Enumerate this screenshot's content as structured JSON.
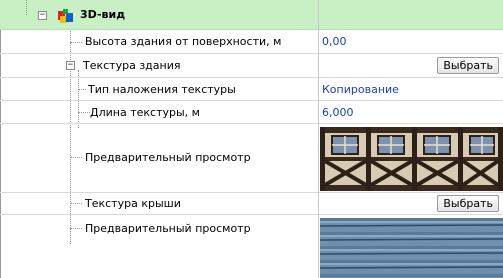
{
  "section": {
    "title": "3D-вид",
    "expander": "−",
    "icon": "3d-blocks-icon",
    "colors": {
      "header_bg": "#c8f0c4",
      "value_text": "#1a3fb3"
    }
  },
  "properties": {
    "height": {
      "label": "Высота здания от поверхности, м",
      "value": "0,00"
    },
    "building_texture": {
      "label": "Текстура здания",
      "button": "Выбрать",
      "expander": "−"
    },
    "texture_mode": {
      "label": "Тип наложения текстуры",
      "value": "Копирование"
    },
    "texture_length": {
      "label": "Длина текстуры, м",
      "value": "6,000"
    },
    "building_preview": {
      "label": "Предварительный просмотр"
    },
    "roof_texture": {
      "label": "Текстура крыши",
      "button": "Выбрать"
    },
    "roof_preview": {
      "label": "Предварительный просмотр"
    }
  }
}
